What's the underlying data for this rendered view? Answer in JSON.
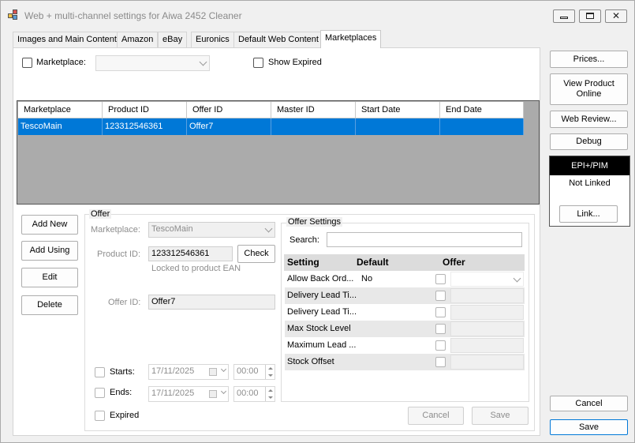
{
  "window": {
    "title": "Web + multi-channel settings for Aiwa 2452 Cleaner"
  },
  "tabs": [
    {
      "label": "Images and Main Content"
    },
    {
      "label": "Amazon"
    },
    {
      "label": "eBay"
    },
    {
      "label": "Euronics"
    },
    {
      "label": "Default Web Content"
    },
    {
      "label": "Marketplaces"
    }
  ],
  "filter": {
    "marketplace_label": "Marketplace:",
    "marketplace_value": "",
    "show_expired_label": "Show Expired"
  },
  "grid": {
    "columns": [
      "Marketplace",
      "Product ID",
      "Offer ID",
      "Master ID",
      "Start Date",
      "End Date"
    ],
    "rows": [
      [
        "TescoMain",
        "123312546361",
        "Offer7",
        "",
        "",
        ""
      ]
    ]
  },
  "actions": {
    "add_new": "Add New",
    "add_using": "Add Using",
    "edit": "Edit",
    "delete": "Delete"
  },
  "offer": {
    "group_title": "Offer",
    "marketplace_label": "Marketplace:",
    "marketplace_value": "TescoMain",
    "product_id_label": "Product ID:",
    "product_id_value": "123312546361",
    "check_button": "Check",
    "locked_note": "Locked to product EAN",
    "offer_id_label": "Offer ID:",
    "offer_id_value": "Offer7",
    "starts_label": "Starts:",
    "starts_date": "17/11/2025",
    "starts_time": "00:00",
    "ends_label": "Ends:",
    "ends_date": "17/11/2025",
    "ends_time": "00:00",
    "expired_label": "Expired",
    "cancel_button": "Cancel",
    "save_button": "Save"
  },
  "offer_settings": {
    "group_title": "Offer Settings",
    "search_label": "Search:",
    "search_value": "",
    "headers": {
      "setting": "Setting",
      "default": "Default",
      "offer": "Offer"
    },
    "rows": [
      {
        "setting": "Allow Back Ord...",
        "default": "No"
      },
      {
        "setting": "Delivery Lead Ti...",
        "default": ""
      },
      {
        "setting": "Delivery Lead Ti...",
        "default": ""
      },
      {
        "setting": "Max Stock Level",
        "default": ""
      },
      {
        "setting": "Maximum Lead ...",
        "default": ""
      },
      {
        "setting": "Stock Offset",
        "default": ""
      }
    ]
  },
  "sidebar": {
    "prices": "Prices...",
    "view_product_online_line1": "View Product",
    "view_product_online_line2": "Online",
    "web_review": "Web Review...",
    "debug": "Debug",
    "epi_title": "EPI+/PIM",
    "epi_status": "Not Linked",
    "link": "Link...",
    "cancel": "Cancel",
    "save": "Save"
  },
  "icons": [
    "app-icon",
    "minimize-icon",
    "maximize-icon",
    "close-icon",
    "chevron-down-icon",
    "calendar-icon",
    "spinner-icon"
  ]
}
